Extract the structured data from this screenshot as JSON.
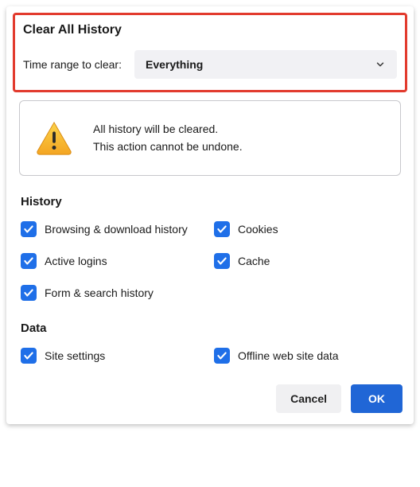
{
  "dialog": {
    "title": "Clear All History",
    "time_range_label": "Time range to clear:",
    "time_range_value": "Everything"
  },
  "warning": {
    "line1": "All history will be cleared.",
    "line2": "This action cannot be undone."
  },
  "sections": {
    "history": {
      "title": "History",
      "items": [
        {
          "label": "Browsing & download history",
          "checked": true
        },
        {
          "label": "Cookies",
          "checked": true
        },
        {
          "label": "Active logins",
          "checked": true
        },
        {
          "label": "Cache",
          "checked": true
        },
        {
          "label": "Form & search history",
          "checked": true
        }
      ]
    },
    "data": {
      "title": "Data",
      "items": [
        {
          "label": "Site settings",
          "checked": true
        },
        {
          "label": "Offline web site data",
          "checked": true
        }
      ]
    }
  },
  "actions": {
    "cancel": "Cancel",
    "ok": "OK"
  }
}
